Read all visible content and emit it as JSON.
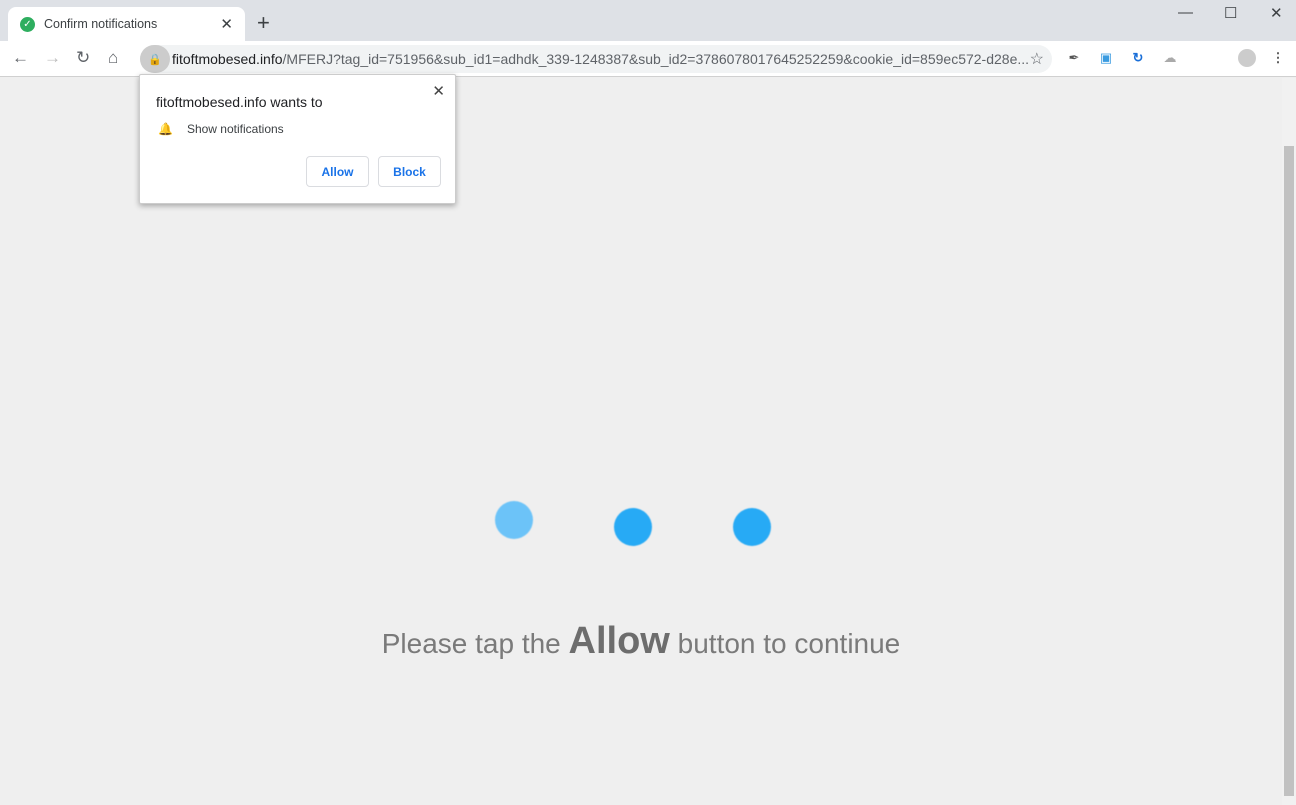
{
  "tab": {
    "title": "Confirm notifications",
    "icon": "check-circle-icon"
  },
  "window": {
    "minimize": "—",
    "maximize": "☐",
    "close": "✕"
  },
  "omnibox": {
    "host": "fitoftmobesed.info",
    "path": "/MFERJ?tag_id=751956&sub_id1=adhdk_339-1248387&sub_id2=3786078017645252259&cookie_id=859ec572-d28e..."
  },
  "popup": {
    "title": "fitoftmobesed.info wants to",
    "permission": "Show notifications",
    "allow": "Allow",
    "block": "Block"
  },
  "page": {
    "msg_before": "Please tap the ",
    "msg_bold": "Allow",
    "msg_after": " button to continue",
    "dot_color": "#27aaf5"
  }
}
